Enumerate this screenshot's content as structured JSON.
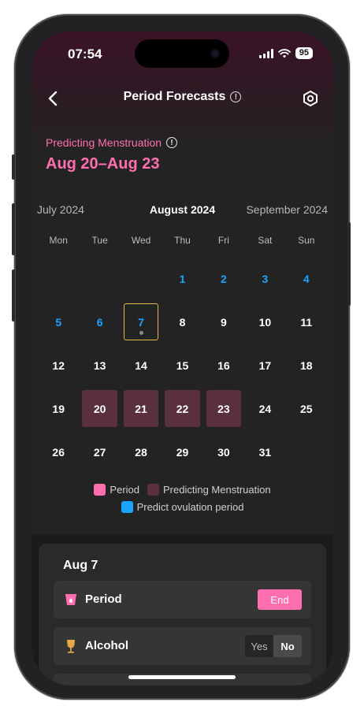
{
  "status_bar": {
    "time": "07:54",
    "battery": "95"
  },
  "nav": {
    "title": "Period Forecasts"
  },
  "prediction": {
    "label": "Predicting Menstruation",
    "range": "Aug 20–Aug 23"
  },
  "months": {
    "prev": "July 2024",
    "current": "August 2024",
    "next": "September 2024"
  },
  "weekdays": [
    "Mon",
    "Tue",
    "Wed",
    "Thu",
    "Fri",
    "Sat",
    "Sun"
  ],
  "weeks": [
    [
      {
        "day": "",
        "kind": "empty"
      },
      {
        "day": "",
        "kind": "empty"
      },
      {
        "day": "",
        "kind": "empty"
      },
      {
        "day": "1",
        "kind": "ovulation"
      },
      {
        "day": "2",
        "kind": "ovulation"
      },
      {
        "day": "3",
        "kind": "ovulation"
      },
      {
        "day": "4",
        "kind": "ovulation"
      }
    ],
    [
      {
        "day": "5",
        "kind": "ovulation"
      },
      {
        "day": "6",
        "kind": "ovulation"
      },
      {
        "day": "7",
        "kind": "today"
      },
      {
        "day": "8",
        "kind": "normal"
      },
      {
        "day": "9",
        "kind": "normal"
      },
      {
        "day": "10",
        "kind": "normal"
      },
      {
        "day": "11",
        "kind": "normal"
      }
    ],
    [
      {
        "day": "12",
        "kind": "normal"
      },
      {
        "day": "13",
        "kind": "normal"
      },
      {
        "day": "14",
        "kind": "normal"
      },
      {
        "day": "15",
        "kind": "normal"
      },
      {
        "day": "16",
        "kind": "normal"
      },
      {
        "day": "17",
        "kind": "normal"
      },
      {
        "day": "18",
        "kind": "normal"
      }
    ],
    [
      {
        "day": "19",
        "kind": "normal"
      },
      {
        "day": "20",
        "kind": "predicted"
      },
      {
        "day": "21",
        "kind": "predicted"
      },
      {
        "day": "22",
        "kind": "predicted"
      },
      {
        "day": "23",
        "kind": "predicted"
      },
      {
        "day": "24",
        "kind": "normal"
      },
      {
        "day": "25",
        "kind": "normal"
      }
    ],
    [
      {
        "day": "26",
        "kind": "normal"
      },
      {
        "day": "27",
        "kind": "normal"
      },
      {
        "day": "28",
        "kind": "normal"
      },
      {
        "day": "29",
        "kind": "normal"
      },
      {
        "day": "30",
        "kind": "normal"
      },
      {
        "day": "31",
        "kind": "normal"
      },
      {
        "day": "",
        "kind": "empty"
      }
    ]
  ],
  "legend": {
    "period": "Period",
    "predicting": "Predicting Menstruation",
    "ovulation": "Predict ovulation period"
  },
  "colors": {
    "period": "#ff6fb0",
    "predicting": "#5a3040",
    "ovulation": "#1aa3ff",
    "today_border": "#e3b84a"
  },
  "detail": {
    "date": "Aug 7",
    "period": {
      "label": "Period",
      "icon": "period-icon",
      "button": "End"
    },
    "alcohol": {
      "label": "Alcohol",
      "icon": "wine-glass-icon",
      "yes": "Yes",
      "no": "No",
      "selected": "No"
    }
  }
}
